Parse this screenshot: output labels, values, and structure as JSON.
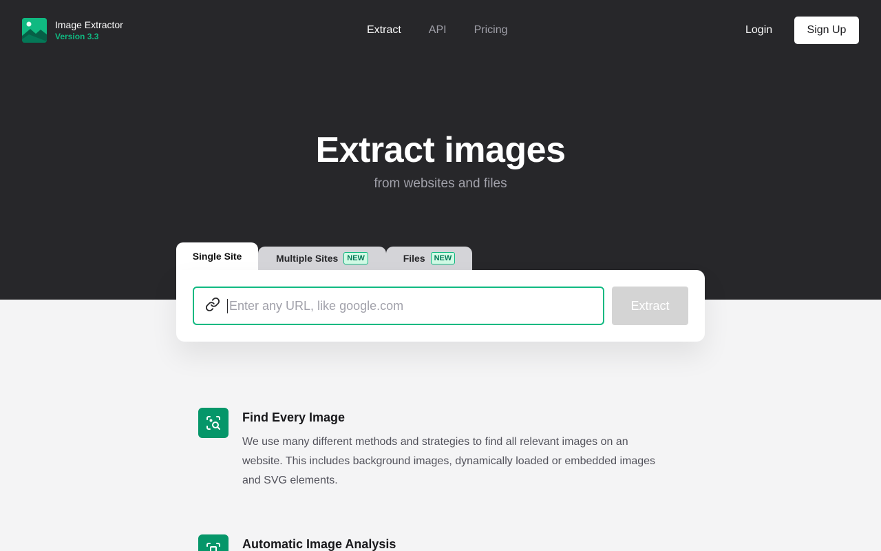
{
  "header": {
    "app_name": "Image Extractor",
    "version": "Version 3.3",
    "nav": [
      {
        "label": "Extract",
        "active": true
      },
      {
        "label": "API",
        "active": false
      },
      {
        "label": "Pricing",
        "active": false
      }
    ],
    "login_label": "Login",
    "signup_label": "Sign Up"
  },
  "hero": {
    "title": "Extract images",
    "subtitle": "from websites and files"
  },
  "tabs": [
    {
      "label": "Single Site",
      "badge": ""
    },
    {
      "label": "Multiple Sites",
      "badge": "NEW"
    },
    {
      "label": "Files",
      "badge": "NEW"
    }
  ],
  "search": {
    "placeholder": "Enter any URL, like google.com",
    "value": "",
    "extract_label": "Extract"
  },
  "features": [
    {
      "title": "Find Every Image",
      "description": "We use many different methods and strategies to find all relevant images on an website. This includes background images, dynamically loaded or embedded images and SVG elements.",
      "icon": "image-search-icon"
    },
    {
      "title": "Automatic Image Analysis",
      "description": "",
      "icon": "image-analysis-icon"
    }
  ],
  "colors": {
    "accent": "#10b981",
    "dark_bg": "#27272a",
    "light_bg": "#f4f4f5"
  }
}
